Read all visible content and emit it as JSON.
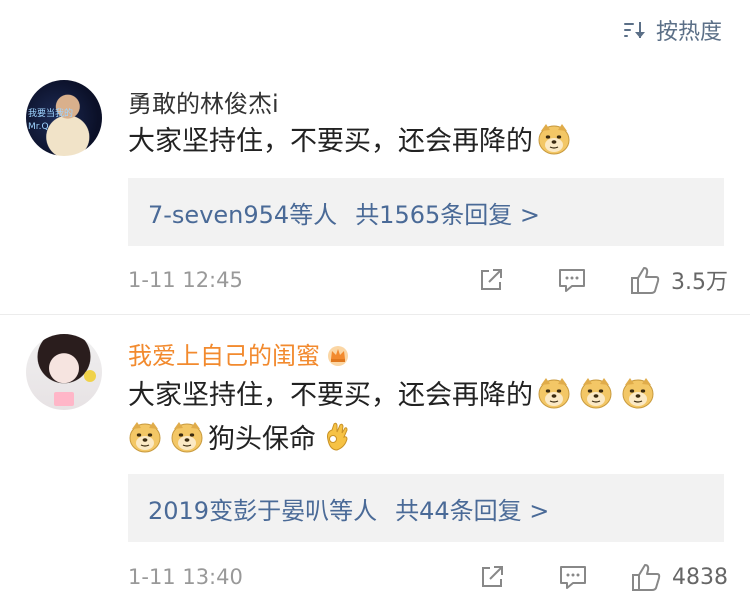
{
  "header": {
    "sort_label": "按热度"
  },
  "comments": [
    {
      "username": "勇敢的林俊杰i",
      "avatar_text_1": "我要当我的",
      "avatar_text_2": "Mr.Q",
      "text_line_1": "大家坚持住，不要买，还会再降的",
      "text_line_2": "",
      "replies_users": "7-seven954等人",
      "replies_count": "共1565条回复 >",
      "time": "1-11 12:45",
      "likes": "3.5万",
      "vip": false
    },
    {
      "username": "我爱上自己的闺蜜",
      "avatar_text_1": "",
      "avatar_text_2": "",
      "text_line_1": "大家坚持住，不要买，还会再降的",
      "text_line_2": "狗头保命",
      "replies_users": "2019变彭于晏叭等人",
      "replies_count": "共44条回复 >",
      "time": "1-11 13:40",
      "likes": "4838",
      "vip": true
    }
  ],
  "icons": {
    "sort": "sort-icon",
    "doge": "doge-emoji-icon",
    "ok_hand": "ok-hand-emoji-icon",
    "share": "share-icon",
    "comment": "comment-icon",
    "like": "thumbs-up-icon",
    "crown": "vip-crown-icon"
  },
  "colors": {
    "link": "#4a6a97",
    "vip_name": "#f28a2e",
    "reply_bg": "#f2f2f2",
    "meta": "#999999"
  }
}
